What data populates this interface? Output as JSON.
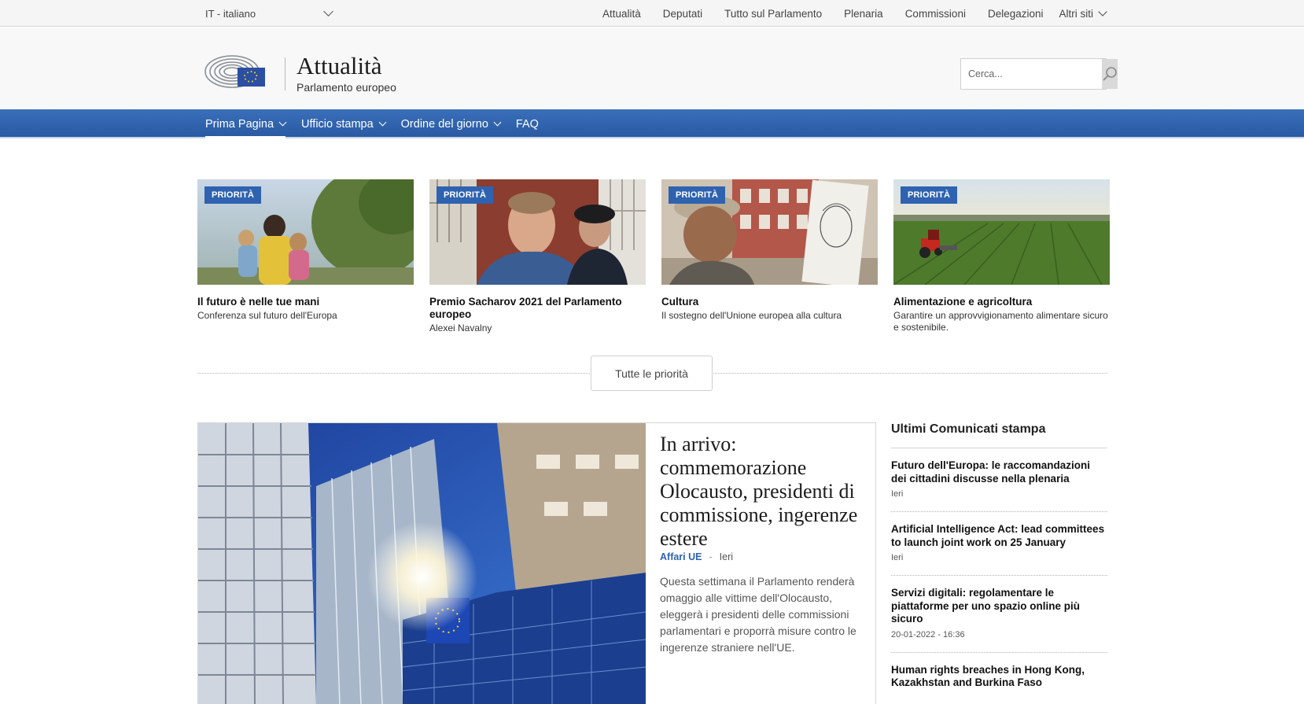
{
  "language": {
    "label": "IT - italiano"
  },
  "top_links": [
    "Attualità",
    "Deputati",
    "Tutto sul Parlamento",
    "Plenaria",
    "Commissioni",
    "Delegazioni"
  ],
  "top_more": "Altri siti",
  "brand": {
    "title": "Attualità",
    "subtitle": "Parlamento europeo"
  },
  "search": {
    "placeholder": "Cerca..."
  },
  "nav": [
    {
      "label": "Prima Pagina",
      "active": true
    },
    {
      "label": "Ufficio stampa"
    },
    {
      "label": "Ordine del giorno"
    },
    {
      "label": "FAQ"
    }
  ],
  "priorities": [
    {
      "badge": "PRIORITÀ",
      "title": "Il futuro è nelle tue mani",
      "subtitle": "Conferenza sul futuro dell'Europa"
    },
    {
      "badge": "PRIORITÀ",
      "title": "Premio Sacharov 2021 del Parlamento europeo",
      "subtitle": "Alexei Navalny"
    },
    {
      "badge": "PRIORITÀ",
      "title": "Cultura",
      "subtitle": "Il sostegno dell'Unione europea alla cultura"
    },
    {
      "badge": "PRIORITÀ",
      "title": "Alimentazione e agricoltura",
      "subtitle": "Garantire un approvvigionamento alimentare sicuro e sostenibile."
    }
  ],
  "all_priorities_label": "Tutte le priorità",
  "main_article": {
    "title": "In arrivo: commemorazione Olocausto, presidenti di commissione, ingerenze estere",
    "category": "Affari UE",
    "separator": "-",
    "date": "Ieri",
    "description": "Questa settimana il Parlamento renderà omaggio alle vittime dell'Olocausto, eleggerà i presidenti delle commissioni parlamentari e proporrà misure contro le ingerenze straniere nell'UE."
  },
  "press": {
    "heading": "Ultimi Comunicati stampa",
    "items": [
      {
        "title": "Futuro dell'Europa: le raccomandazioni dei cittadini discusse nella plenaria",
        "date": "Ieri"
      },
      {
        "title": "Artificial Intelligence Act: lead committees to launch joint work on 25 January",
        "date": "Ieri"
      },
      {
        "title": "Servizi digitali: regolamentare le piattaforme per uno spazio online più sicuro",
        "date": "20-01-2022 - 16:36"
      },
      {
        "title": "Human rights breaches in Hong Kong, Kazakhstan and Burkina Faso",
        "date": ""
      }
    ]
  },
  "colors": {
    "brand_blue": "#2f63b0",
    "nav_blue": "#2a5aa3"
  }
}
